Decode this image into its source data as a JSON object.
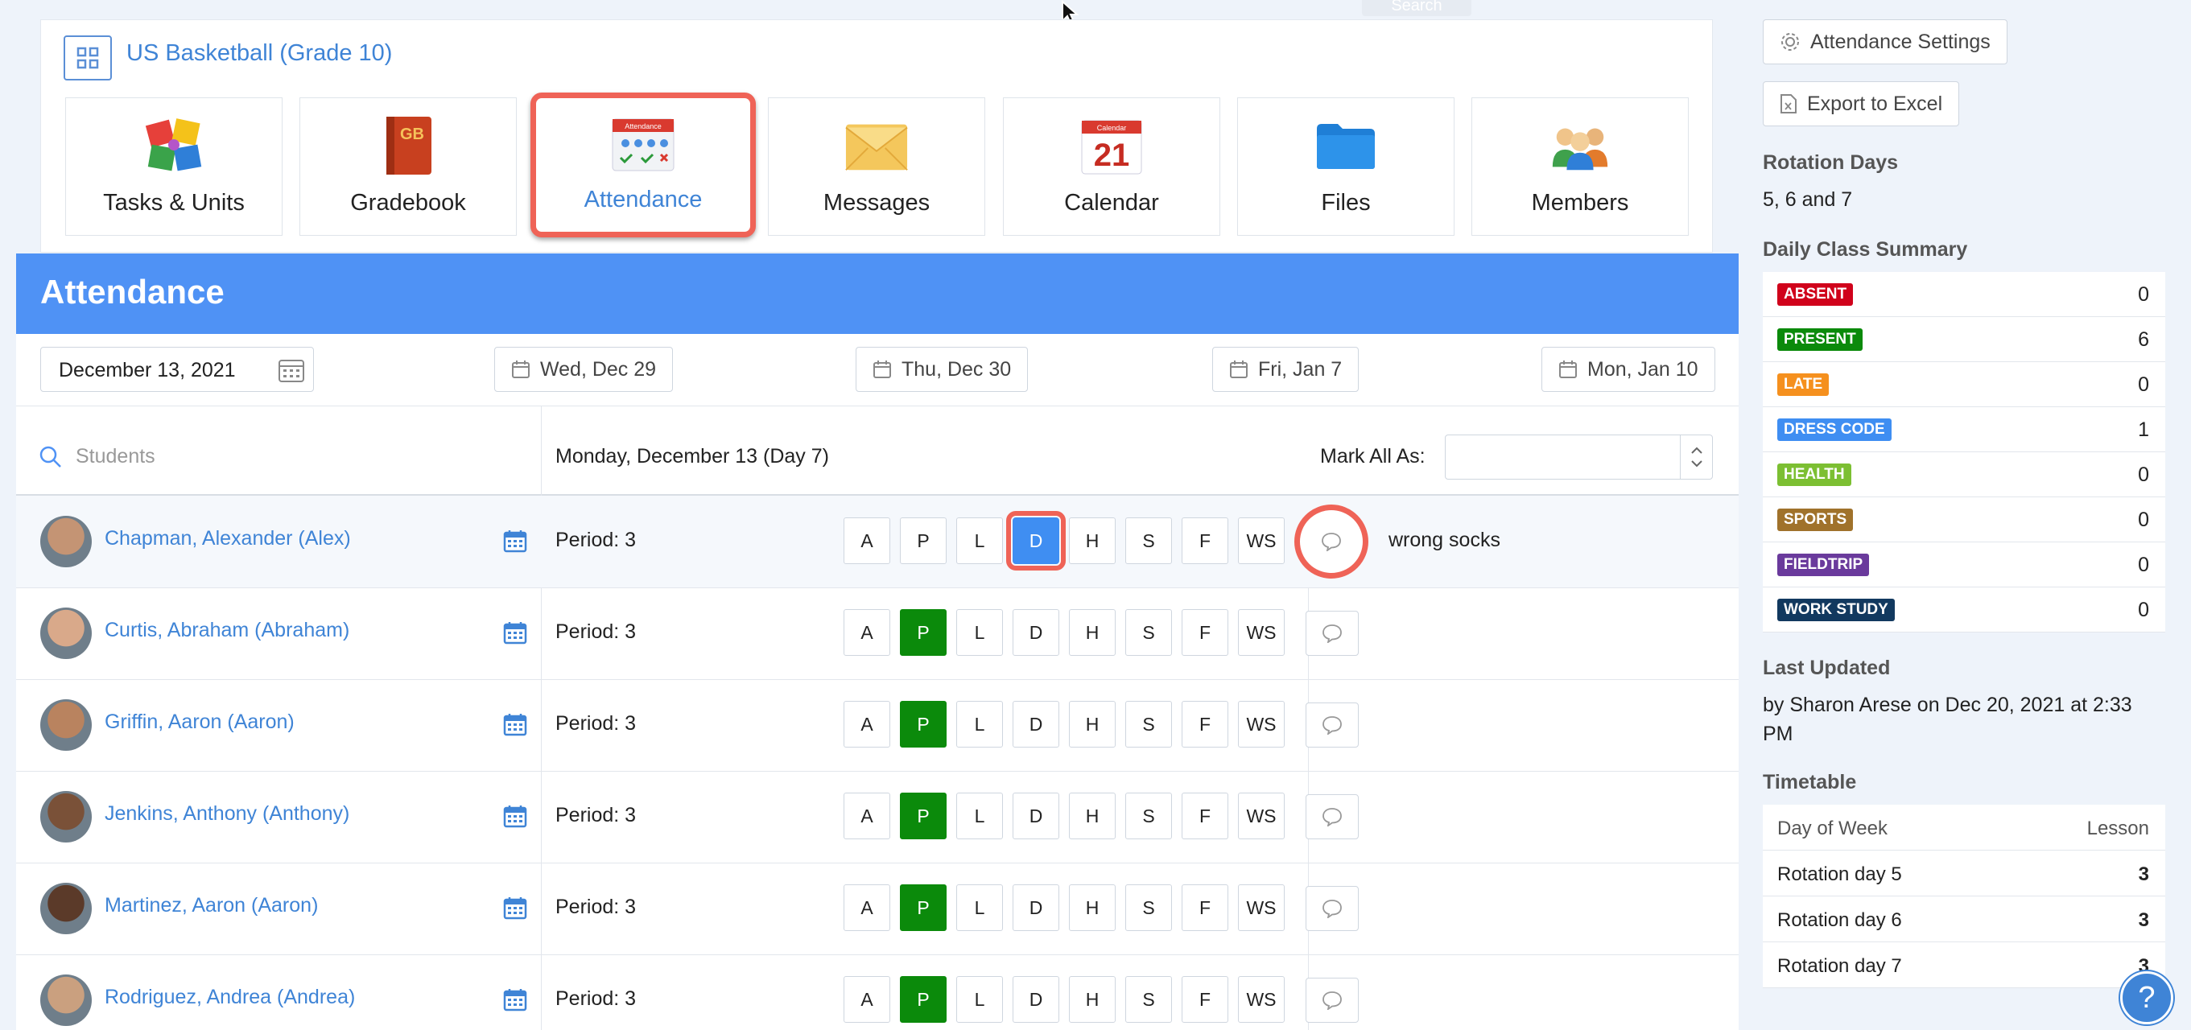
{
  "course": {
    "title": "US Basketball (Grade 10)"
  },
  "topbar": {
    "search_label": "Search"
  },
  "tiles": [
    {
      "label": "Tasks & Units",
      "icon": "puzzle-icon"
    },
    {
      "label": "Gradebook",
      "icon": "gradebook-icon",
      "icon_text": "GB"
    },
    {
      "label": "Attendance",
      "icon": "attendance-icon",
      "icon_text": "Attendance",
      "active": true
    },
    {
      "label": "Messages",
      "icon": "envelope-icon"
    },
    {
      "label": "Calendar",
      "icon": "calendar-icon",
      "icon_text": "Calendar",
      "day": "21"
    },
    {
      "label": "Files",
      "icon": "folder-icon"
    },
    {
      "label": "Members",
      "icon": "members-icon"
    }
  ],
  "header": {
    "title": "Attendance"
  },
  "date_picker": {
    "value": "December 13, 2021"
  },
  "day_buttons": [
    "Wed, Dec 29",
    "Thu, Dec 30",
    "Fri, Jan 7",
    "Mon, Jan 10"
  ],
  "toolbar": {
    "students_placeholder": "Students",
    "date_label": "Monday, December 13 (Day 7)",
    "mark_all_label": "Mark All As:",
    "mark_all_value": ""
  },
  "codes": [
    "A",
    "P",
    "L",
    "D",
    "H",
    "S",
    "F",
    "WS"
  ],
  "students": [
    {
      "name": "Chapman, Alexander (Alex)",
      "period": "Period: 3",
      "selected": "D",
      "comment": "wrong socks"
    },
    {
      "name": "Curtis, Abraham (Abraham)",
      "period": "Period: 3",
      "selected": "P",
      "comment": ""
    },
    {
      "name": "Griffin, Aaron (Aaron)",
      "period": "Period: 3",
      "selected": "P",
      "comment": ""
    },
    {
      "name": "Jenkins, Anthony (Anthony)",
      "period": "Period: 3",
      "selected": "P",
      "comment": ""
    },
    {
      "name": "Martinez, Aaron (Aaron)",
      "period": "Period: 3",
      "selected": "P",
      "comment": ""
    },
    {
      "name": "Rodriguez, Andrea (Andrea)",
      "period": "Period: 3",
      "selected": "P",
      "comment": ""
    }
  ],
  "right_panel": {
    "settings_button": "Attendance Settings",
    "export_button": "Export to Excel",
    "rotation_heading": "Rotation Days",
    "rotation_value": "5, 6 and 7",
    "summary_heading": "Daily Class Summary",
    "summary": [
      {
        "label": "ABSENT",
        "count": "0",
        "color": "#d0021b"
      },
      {
        "label": "PRESENT",
        "count": "6",
        "color": "#0b8a0b"
      },
      {
        "label": "LATE",
        "count": "0",
        "color": "#f5901e"
      },
      {
        "label": "DRESS CODE",
        "count": "1",
        "color": "#3f8ef2"
      },
      {
        "label": "HEALTH",
        "count": "0",
        "color": "#7cbf32"
      },
      {
        "label": "SPORTS",
        "count": "0",
        "color": "#a0722b"
      },
      {
        "label": "FIELDTRIP",
        "count": "0",
        "color": "#6a3a9c"
      },
      {
        "label": "WORK STUDY",
        "count": "0",
        "color": "#12395f"
      }
    ],
    "updated_heading": "Last Updated",
    "updated_value": "by Sharon Arese on Dec 20, 2021 at 2:33 PM",
    "timetable_heading": "Timetable",
    "timetable_cols": [
      "Day of Week",
      "Lesson"
    ],
    "timetable": [
      {
        "day": "Rotation day 5",
        "lesson": "3"
      },
      {
        "day": "Rotation day 6",
        "lesson": "3"
      },
      {
        "day": "Rotation day 7",
        "lesson": "3"
      }
    ]
  },
  "help": {
    "label": "?"
  }
}
